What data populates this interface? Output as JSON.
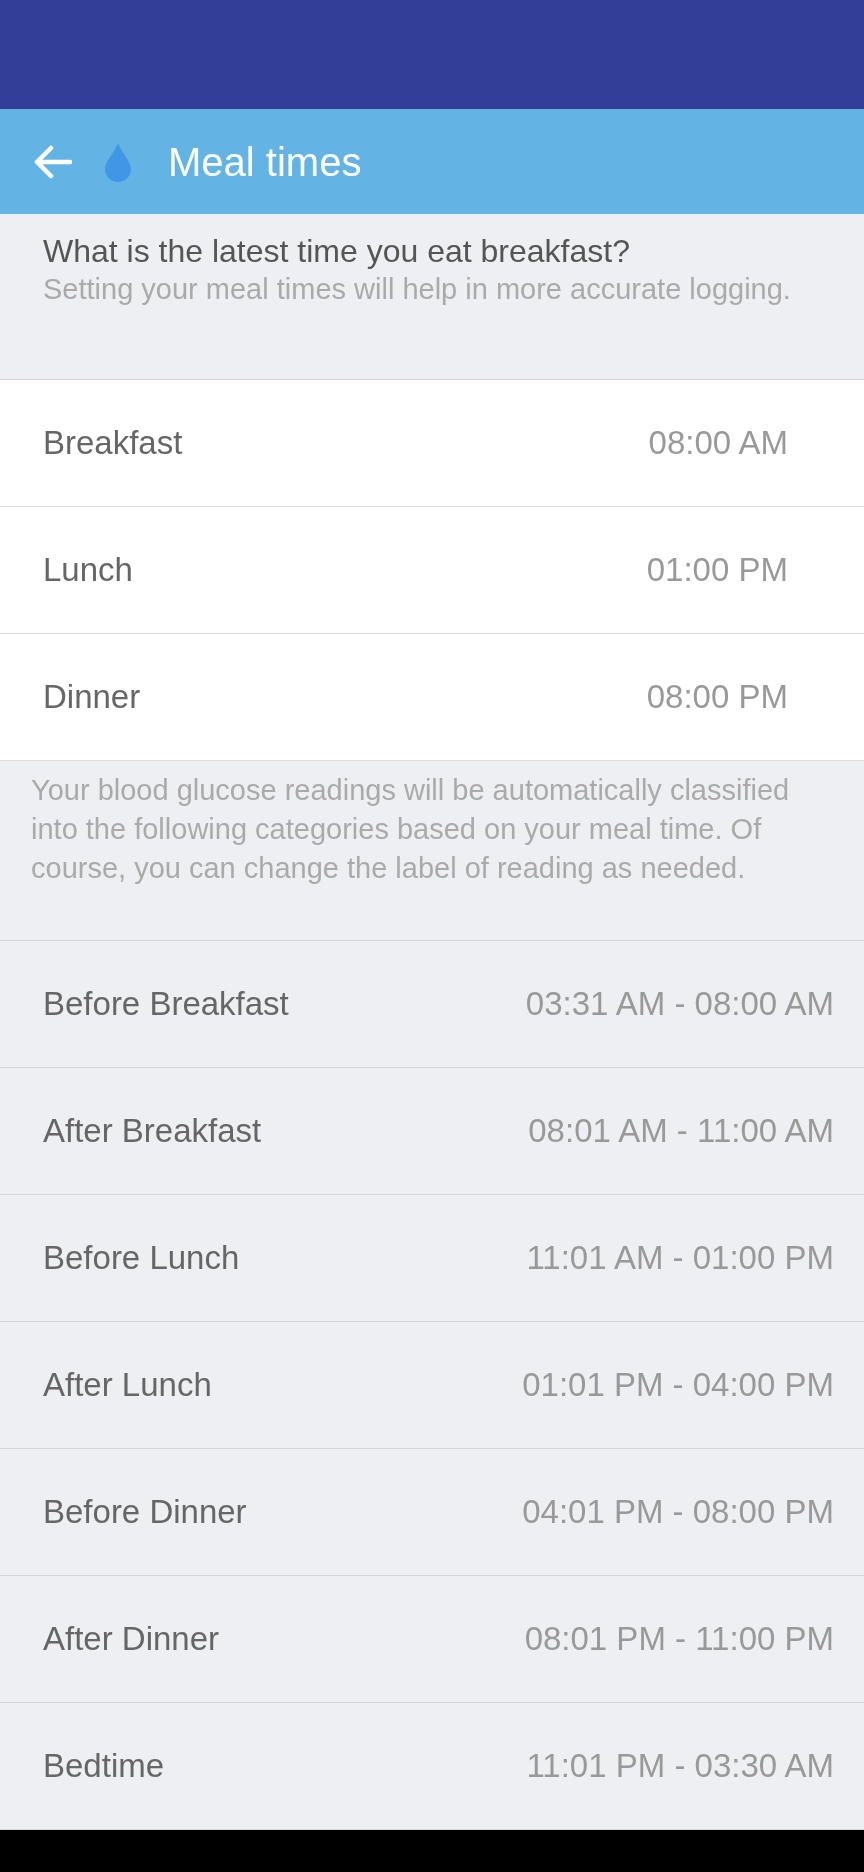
{
  "header": {
    "title": "Meal times"
  },
  "intro": {
    "question": "What is the latest time you eat breakfast?",
    "hint": "Setting your meal times will help in more accurate logging."
  },
  "meals": [
    {
      "label": "Breakfast",
      "time": "08:00 AM"
    },
    {
      "label": "Lunch",
      "time": "01:00 PM"
    },
    {
      "label": "Dinner",
      "time": "08:00 PM"
    }
  ],
  "note": "Your blood glucose readings will be automatically classified into the following categories based on your meal time. Of course, you can change the label of reading as needed.",
  "categories": [
    {
      "label": "Before Breakfast",
      "range": "03:31 AM - 08:00 AM"
    },
    {
      "label": "After Breakfast",
      "range": "08:01 AM - 11:00 AM"
    },
    {
      "label": "Before Lunch",
      "range": "11:01 AM - 01:00 PM"
    },
    {
      "label": "After Lunch",
      "range": "01:01 PM - 04:00 PM"
    },
    {
      "label": "Before Dinner",
      "range": "04:01 PM - 08:00 PM"
    },
    {
      "label": "After Dinner",
      "range": "08:01 PM - 11:00 PM"
    },
    {
      "label": "Bedtime",
      "range": "11:01 PM - 03:30 AM"
    }
  ]
}
